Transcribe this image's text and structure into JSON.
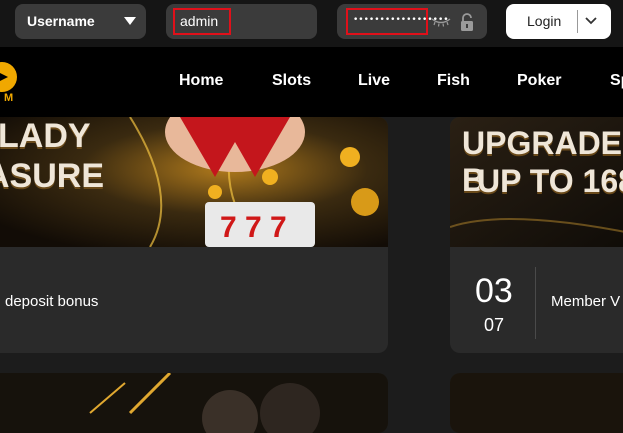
{
  "login_bar": {
    "username_select": "Username",
    "username_value": "admin",
    "password_dots": "••••••••••••••••••",
    "login_label": "Login"
  },
  "nav": {
    "items": [
      "Home",
      "Slots",
      "Live",
      "Fish",
      "Poker",
      "Sp"
    ]
  },
  "promos": [
    {
      "banner_lines": [
        "LADY",
        "ASURE"
      ],
      "description": "deposit bonus"
    },
    {
      "banner_lines": [
        "UPGRADE B",
        "UP TO 168"
      ],
      "date_day": "03",
      "date_month": "07",
      "description": "Member V"
    }
  ],
  "colors": {
    "highlight_box": "#e0101a",
    "arrow": "#e0101a",
    "accent_gold": "#f0a800"
  }
}
